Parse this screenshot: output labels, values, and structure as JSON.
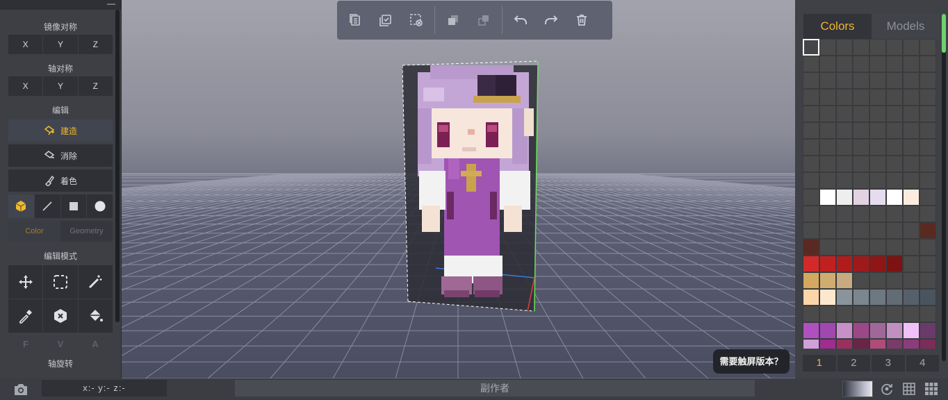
{
  "left_panel": {
    "mirror_title": "镜像对称",
    "mirror_axes": [
      "X",
      "Y",
      "Z"
    ],
    "axis_title": "轴对称",
    "axis_axes": [
      "X",
      "Y",
      "Z"
    ],
    "edit_title": "编辑",
    "build_label": "建造",
    "erase_label": "消除",
    "paint_label": "着色",
    "shapes": [
      "cube-icon",
      "line-icon",
      "square-icon",
      "circle-icon"
    ],
    "tab_color": "Color",
    "tab_geometry": "Geometry",
    "edit_mode_title": "编辑模式",
    "edit_modes": [
      "move-icon",
      "select-box-icon",
      "magic-wand-icon",
      "eyedropper-icon",
      "delete-hex-icon",
      "paint-bucket-icon"
    ],
    "fva": [
      "F",
      "V",
      "A"
    ],
    "axis_rotate_title": "轴旋转"
  },
  "top_toolbar": {
    "buttons": [
      "copy-icon",
      "select-all-icon",
      "deselect-icon",
      "group-icon",
      "ungroup-icon",
      "undo-icon",
      "redo-icon",
      "trash-icon"
    ]
  },
  "right_panel": {
    "tab_colors": "Colors",
    "tab_models": "Models",
    "page_tabs": [
      "1",
      "2",
      "3",
      "4"
    ],
    "swatches": [
      [
        "#ffffff00",
        "#4a4a4a",
        "#4a4a4a",
        "#4a4a4a",
        "#4a4a4a",
        "#4a4a4a",
        "#4a4a4a",
        "#4a4a4a"
      ],
      [
        "#4a4a4a",
        "#4a4a4a",
        "#4a4a4a",
        "#4a4a4a",
        "#4a4a4a",
        "#4a4a4a",
        "#4a4a4a",
        "#4a4a4a"
      ],
      [
        "#4a4a4a",
        "#4a4a4a",
        "#4a4a4a",
        "#4a4a4a",
        "#4a4a4a",
        "#4a4a4a",
        "#4a4a4a",
        "#4a4a4a"
      ],
      [
        "#4a4a4a",
        "#4a4a4a",
        "#4a4a4a",
        "#4a4a4a",
        "#4a4a4a",
        "#4a4a4a",
        "#4a4a4a",
        "#4a4a4a"
      ],
      [
        "#4a4a4a",
        "#4a4a4a",
        "#4a4a4a",
        "#4a4a4a",
        "#4a4a4a",
        "#4a4a4a",
        "#4a4a4a",
        "#4a4a4a"
      ],
      [
        "#4a4a4a",
        "#4a4a4a",
        "#4a4a4a",
        "#4a4a4a",
        "#4a4a4a",
        "#4a4a4a",
        "#4a4a4a",
        "#4a4a4a"
      ],
      [
        "#4a4a4a",
        "#4a4a4a",
        "#4a4a4a",
        "#4a4a4a",
        "#4a4a4a",
        "#4a4a4a",
        "#4a4a4a",
        "#4a4a4a"
      ],
      [
        "#4a4a4a",
        "#4a4a4a",
        "#4a4a4a",
        "#4a4a4a",
        "#4a4a4a",
        "#4a4a4a",
        "#4a4a4a",
        "#4a4a4a"
      ],
      [
        "#4a4a4a",
        "#4a4a4a",
        "#4a4a4a",
        "#4a4a4a",
        "#4a4a4a",
        "#4a4a4a",
        "#4a4a4a",
        "#4a4a4a"
      ],
      [
        "#4a4a4a",
        "#ffffff",
        "#eeeeee",
        "#e2d2e2",
        "#e6dcef",
        "#ffffff",
        "#fcece0",
        "#4a4a4a"
      ],
      [
        "#4a4a4a",
        "#4a4a4a",
        "#4a4a4a",
        "#4a4a4a",
        "#4a4a4a",
        "#4a4a4a",
        "#4a4a4a",
        "#4a4a4a"
      ],
      [
        "#4a4a4a",
        "#4a4a4a",
        "#4a4a4a",
        "#4a4a4a",
        "#4a4a4a",
        "#4a4a4a",
        "#4a4a4a",
        "#5a2a22"
      ],
      [
        "#5a2a22",
        "#4a4a4a",
        "#4a4a4a",
        "#4a4a4a",
        "#4a4a4a",
        "#4a4a4a",
        "#4a4a4a",
        "#4a4a4a"
      ],
      [
        "#d22a2a",
        "#c02020",
        "#b01c1c",
        "#9e1a1a",
        "#8e1616",
        "#7e1212",
        "#4a4a4a",
        "#4a4a4a"
      ],
      [
        "#d4a860",
        "#d0ac70",
        "#c8aa80",
        "#4a4a4a",
        "#4a4a4a",
        "#4a4a4a",
        "#4a4a4a",
        "#4a4a4a"
      ],
      [
        "#fcd6a8",
        "#fce8cc",
        "#8a949c",
        "#7c868e",
        "#6e7880",
        "#626c74",
        "#56606a",
        "#4a545e"
      ],
      [
        "#4a4a4a",
        "#4a4a4a",
        "#4a4a4a",
        "#4a4a4a",
        "#4a4a4a",
        "#4a4a4a",
        "#4a4a4a",
        "#4a4a4a"
      ],
      [
        "#b050c0",
        "#a048b0",
        "#c890c8",
        "#9c4888",
        "#a06898",
        "#c090c0",
        "#f0c0f8",
        "#6a3a6a"
      ],
      [
        "#d0a0d8",
        "#a02c90",
        "#9a3060",
        "#6a2448",
        "#b04c7a",
        "#7a3a6a",
        "#8c3c7a",
        "#7c2c5a"
      ]
    ]
  },
  "tooltip": "需要触屏版本？",
  "bottom_bar": {
    "coords": "x:-  y:-  z:-",
    "coauthor": "副作者"
  }
}
